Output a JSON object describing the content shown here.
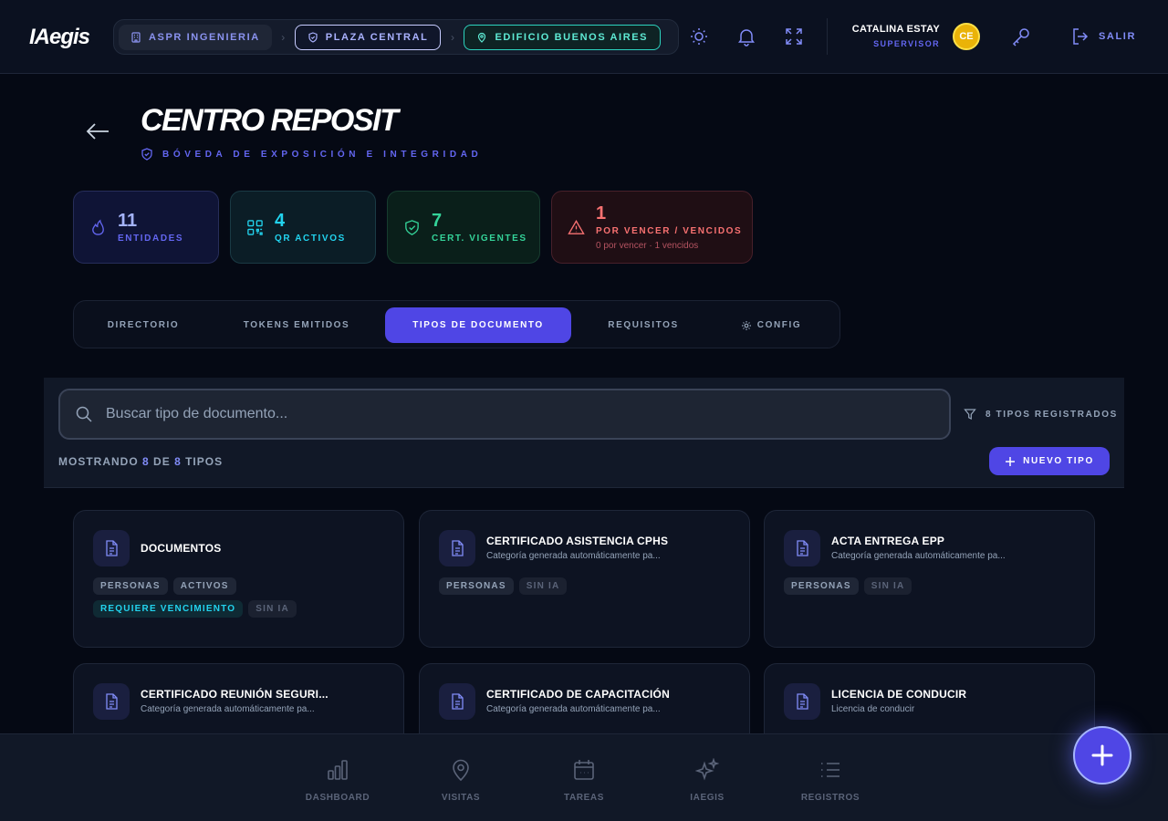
{
  "header": {
    "logo": "IAegis",
    "breadcrumbs": [
      "ASPR INGENIERIA",
      "PLAZA CENTRAL",
      "EDIFICIO BUENOS AIRES"
    ],
    "user_name": "CATALINA ESTAY",
    "user_role": "SUPERVISOR",
    "avatar_initials": "CE",
    "logout_label": "SALIR"
  },
  "page": {
    "title": "CENTRO REPOSIT",
    "subtitle": "BÓVEDA DE EXPOSICIÓN E INTEGRIDAD"
  },
  "stats": [
    {
      "value": "11",
      "label": "ENTIDADES"
    },
    {
      "value": "4",
      "label": "QR ACTIVOS"
    },
    {
      "value": "7",
      "label": "CERT. VIGENTES"
    },
    {
      "value": "1",
      "label": "POR VENCER / VENCIDOS",
      "sub": "0 por vencer · 1 vencidos"
    }
  ],
  "tabs": [
    "DIRECTORIO",
    "TOKENS EMITIDOS",
    "TIPOS DE DOCUMENTO",
    "REQUISITOS",
    "CONFIG"
  ],
  "active_tab": "TIPOS DE DOCUMENTO",
  "search": {
    "placeholder": "Buscar tipo de documento...",
    "registered_label": "8 TIPOS REGISTRADOS"
  },
  "listing": {
    "prefix": "MOSTRANDO",
    "shown": "8",
    "of": "DE",
    "total": "8",
    "suffix": "TIPOS",
    "new_button": "NUEVO TIPO"
  },
  "doc_types": [
    {
      "title": "DOCUMENTOS",
      "desc": "",
      "tags": [
        "PERSONAS",
        "ACTIVOS",
        "REQUIERE VENCIMIENTO",
        "SIN IA"
      ]
    },
    {
      "title": "CERTIFICADO ASISTENCIA CPHS",
      "desc": "Categoría generada automáticamente pa...",
      "tags": [
        "PERSONAS",
        "SIN IA"
      ]
    },
    {
      "title": "ACTA ENTREGA EPP",
      "desc": "Categoría generada automáticamente pa...",
      "tags": [
        "PERSONAS",
        "SIN IA"
      ]
    },
    {
      "title": "CERTIFICADO REUNIÓN SEGURI...",
      "desc": "Categoría generada automáticamente pa...",
      "tags": []
    },
    {
      "title": "CERTIFICADO DE CAPACITACIÓN",
      "desc": "Categoría generada automáticamente pa...",
      "tags": []
    },
    {
      "title": "LICENCIA DE CONDUCIR",
      "desc": "Licencia de conducir",
      "tags": []
    }
  ],
  "bottom_nav": [
    "DASHBOARD",
    "VISITAS",
    "TAREAS",
    "IAEGIS",
    "REGISTROS"
  ],
  "colors": {
    "accent": "#4f46e5",
    "background": "#050914",
    "cyan": "#22d3ee",
    "green": "#34d399",
    "red": "#f87171"
  }
}
